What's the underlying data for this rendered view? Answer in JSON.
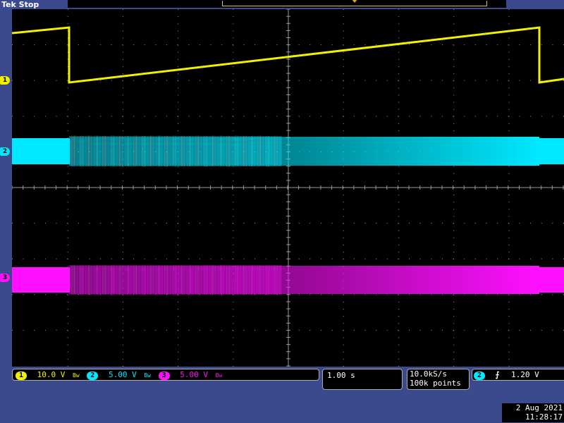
{
  "status": "Tek Stop",
  "colors": {
    "ch1": "#f0f000",
    "ch2": "#00e8ff",
    "ch3": "#ff10ff",
    "background": "#3a4a8c",
    "grid": "#9a9a9a"
  },
  "channels": [
    {
      "id": "1",
      "scale": "10.0 V",
      "bw_icon": "bandwidth-limit-icon",
      "bw_symbol": "Bw"
    },
    {
      "id": "2",
      "scale": "5.00 V",
      "bw_icon": "bandwidth-limit-icon",
      "bw_symbol": "Bw"
    },
    {
      "id": "3",
      "scale": "5.00 V",
      "bw_icon": "bandwidth-limit-icon",
      "bw_symbol": "Bw"
    }
  ],
  "timebase": "1.00 s",
  "acquisition": {
    "sample_rate": "10.0kS/s",
    "record_length": "100k points"
  },
  "trigger": {
    "source": "2",
    "slope_icon": "rising-edge-icon",
    "slope_symbol": "⨍",
    "level": "1.20 V"
  },
  "date": "2 Aug 2021",
  "time": "11:28:17"
}
